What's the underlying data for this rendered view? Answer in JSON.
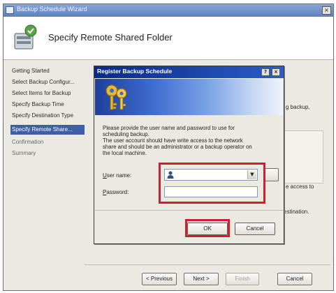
{
  "wizard": {
    "title": "Backup Schedule Wizard",
    "close_glyph": "×",
    "header_title": "Specify Remote Shared Folder",
    "header_icon": "backup-wizard-icon",
    "nav": [
      {
        "label": "Getting Started",
        "state": "normal"
      },
      {
        "label": "Select Backup Configur...",
        "state": "normal"
      },
      {
        "label": "Select Items for Backup",
        "state": "normal"
      },
      {
        "label": "Specify Backup Time",
        "state": "normal"
      },
      {
        "label": "Specify Destination Type",
        "state": "normal"
      },
      {
        "label": "Specify Remote Share...",
        "state": "selected"
      },
      {
        "label": "Confirmation",
        "state": "muted"
      },
      {
        "label": "Summary",
        "state": "muted"
      }
    ],
    "content_fragments": {
      "backup_text": "g backup,",
      "access_text": "e access to",
      "destination_text": "estination."
    },
    "buttons": {
      "previous": "< Previous",
      "next": "Next >",
      "finish": "Finish",
      "cancel": "Cancel"
    }
  },
  "dialog": {
    "title": "Register Backup Schedule",
    "help_glyph": "?",
    "close_glyph": "×",
    "banner_icon": "keys-icon",
    "description": "Please provide the user name and password to use for\nscheduling backup.\nThe user account should have write access to the network\nshare and should be an administrator or a backup operator on\nthe local machine.",
    "user_name_label": "User name:",
    "user_name_access_key": "U",
    "user_name_value": "",
    "user_icon": "user-icon",
    "password_label": "Password:",
    "password_access_key": "P",
    "password_value": "",
    "ok_label": "OK",
    "cancel_label": "Cancel"
  },
  "colors": {
    "highlight": "#d41c2c",
    "selected_nav": "#3e5fa8",
    "dialog_title": "#0a2a86"
  }
}
